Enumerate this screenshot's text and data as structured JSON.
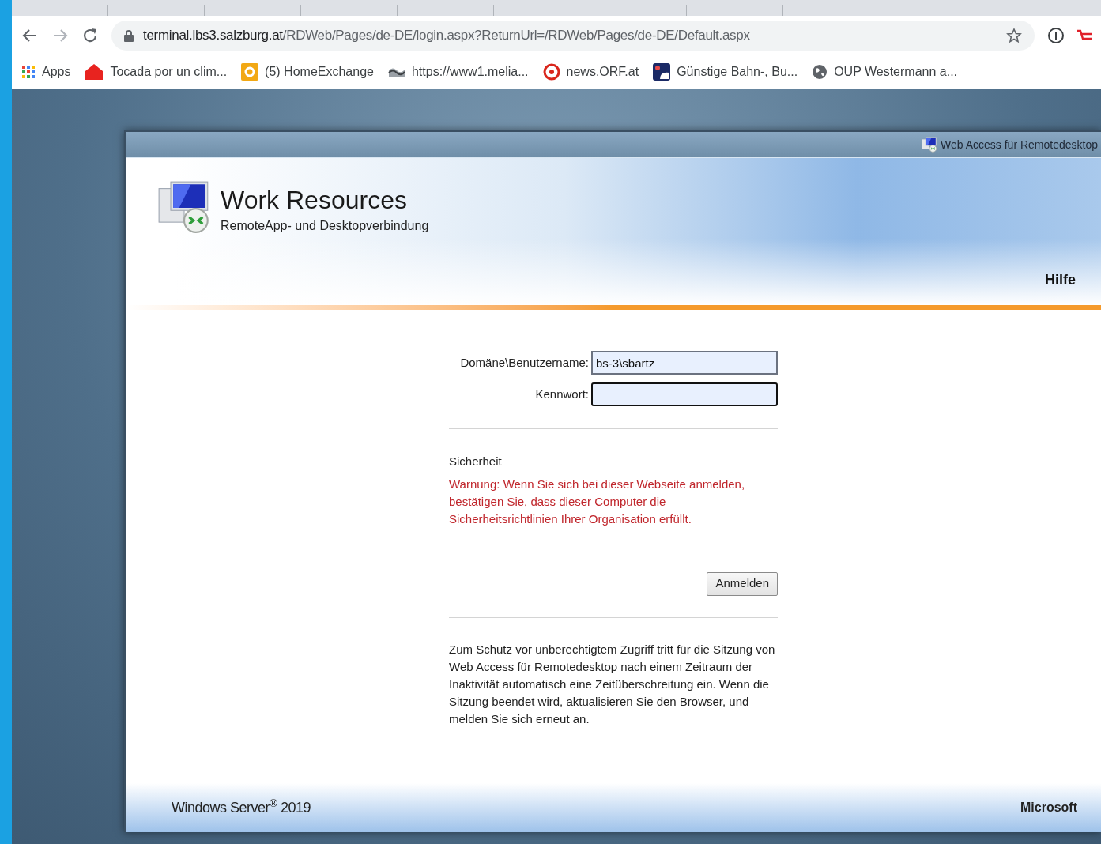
{
  "browser": {
    "address": {
      "host": "terminal.lbs3.salzburg.at",
      "path": "/RDWeb/Pages/de-DE/login.aspx?ReturnUrl=/RDWeb/Pages/de-DE/Default.aspx"
    },
    "bookmarks": [
      {
        "kind": "apps",
        "label": "Apps"
      },
      {
        "kind": "house",
        "label": "Tocada por un clim..."
      },
      {
        "kind": "ring",
        "label": "(5) HomeExchange"
      },
      {
        "kind": "wave",
        "label": "https://www1.melia..."
      },
      {
        "kind": "target",
        "label": "news.ORF.at"
      },
      {
        "kind": "train",
        "label": "Günstige Bahn-, Bu..."
      },
      {
        "kind": "globe",
        "label": "OUP Westermann a..."
      }
    ]
  },
  "page": {
    "header_bar": "Web Access für Remotedesktop",
    "title": "Work Resources",
    "subtitle": "RemoteApp- und Desktopverbindung",
    "help_link": "Hilfe",
    "form": {
      "fields": [
        {
          "kind": "text",
          "label": "Domäne\\Benutzername:",
          "value": "bs-3\\sbartz",
          "focused": false
        },
        {
          "kind": "password",
          "label": "Kennwort:",
          "focused": true
        }
      ],
      "security_heading": "Sicherheit",
      "warning": "Warnung: Wenn Sie sich bei dieser Webseite anmelden, bestätigen Sie, dass dieser Computer die Sicherheitsrichtlinien Ihrer Organisation erfüllt.",
      "submit": "Anmelden",
      "info": "Zum Schutz vor unberechtigtem Zugriff tritt für die Sitzung von Web Access für Remotedesktop nach einem Zeitraum der Inaktivität automatisch eine Zeitüberschreitung ein. Wenn die Sitzung beendet wird, aktualisieren Sie den Browser, und melden Sie sich erneut an."
    },
    "footer": {
      "product": "Windows Server$^{®}$ 2019",
      "brand": "Microsoft"
    }
  }
}
